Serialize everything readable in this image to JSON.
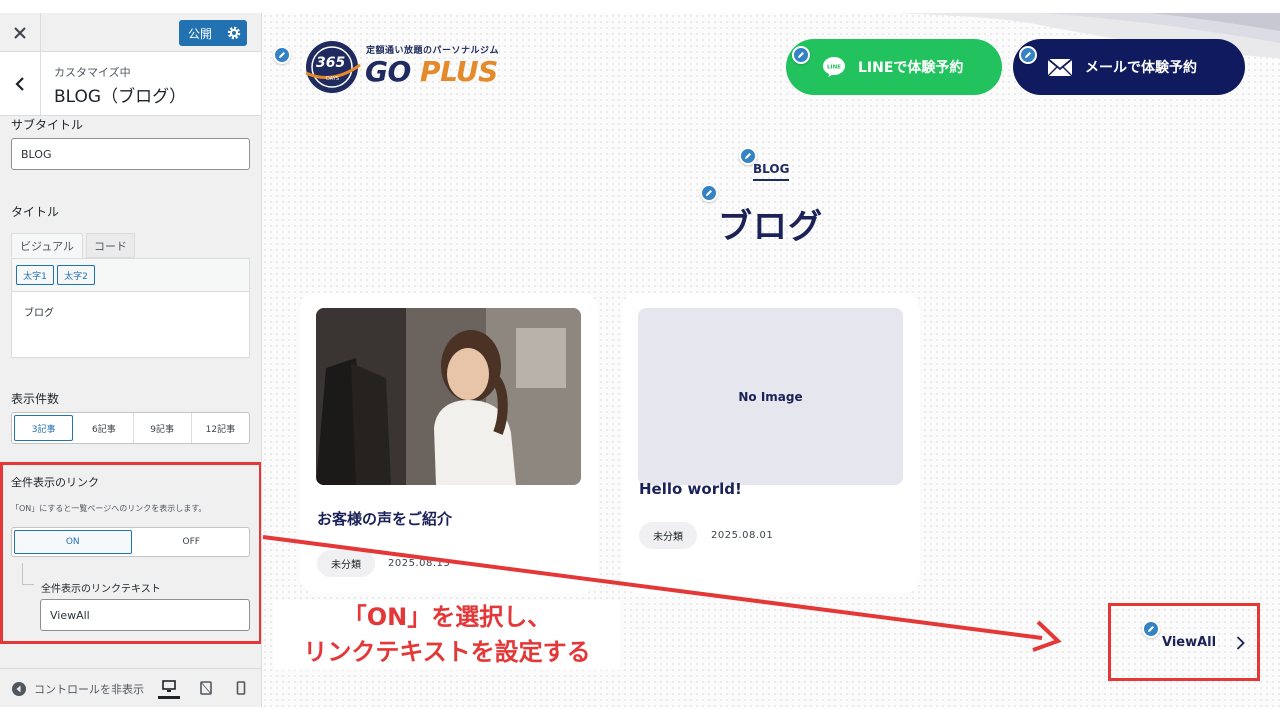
{
  "customizer": {
    "close_icon": "close-icon",
    "publish_label": "公開",
    "publish_gear_icon": "gear-icon",
    "back_icon": "chevron-left-icon",
    "customizing_label": "カスタマイズ中",
    "section_title": "BLOG（ブログ）",
    "subtitle_label": "サブタイトル",
    "subtitle_value": "BLOG",
    "title_label": "タイトル",
    "editor_tabs": [
      "ビジュアル",
      "コード"
    ],
    "quicktags": [
      "太字1",
      "太字2"
    ],
    "editor_content": "ブログ",
    "count_label": "表示件数",
    "count_options": [
      "3記事",
      "6記事",
      "9記事",
      "12記事"
    ],
    "count_selected": "3記事",
    "link_label": "全件表示のリンク",
    "link_description": "「ON」にすると一覧ページへのリンクを表示します。",
    "link_toggle": [
      "ON",
      "OFF"
    ],
    "link_toggle_selected": "ON",
    "link_text_label": "全件表示のリンクテキスト",
    "link_text_value": "ViewAll",
    "collapse_label": "コントロールを非表示",
    "devices": [
      "desktop-icon",
      "tablet-icon",
      "mobile-icon"
    ]
  },
  "preview": {
    "logo": {
      "tagline": "定額通い放題のパーソナルジム",
      "badge_text": "365",
      "badge_sub": "DAYS",
      "name_go": "GO",
      "name_plus": "PLUS"
    },
    "line_button": {
      "icon_text": "LINE",
      "label": "LINEで体験予約"
    },
    "mail_button": {
      "icon": "mail-icon",
      "label": "メールで体験予約"
    },
    "section_subtitle": "BLOG",
    "section_title": "ブログ",
    "cards": [
      {
        "title": "お客様の声をご紹介",
        "category": "未分類",
        "date": "2025.08.13"
      },
      {
        "image_text": "No Image",
        "title": "Hello world!",
        "category": "未分類",
        "date": "2025.08.01"
      }
    ],
    "viewall_label": "ViewAll"
  },
  "annotation": {
    "callout_line1": "「ON」を選択し、",
    "callout_line2": "リンクテキストを設定する"
  },
  "colors": {
    "wp_blue": "#2271b1",
    "navy": "#1a2257",
    "line_green": "#22c35e",
    "annotation_red": "#e43737",
    "logo_orange": "#e58a2b"
  }
}
